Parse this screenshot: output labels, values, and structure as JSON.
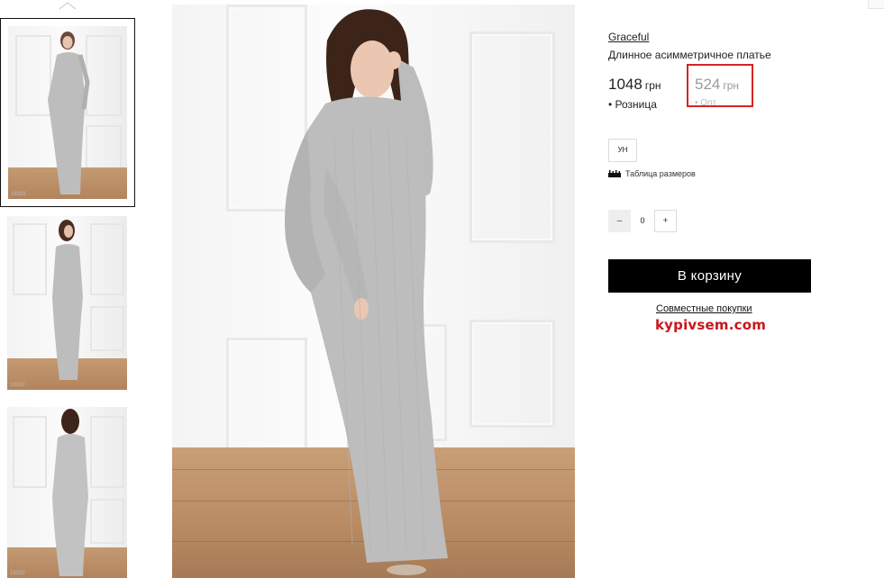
{
  "product": {
    "brand": "Graceful",
    "title": "Длинное асимметричное платье"
  },
  "prices": {
    "retail_value": "1048",
    "retail_currency": "грн",
    "retail_label": "• Розница",
    "wholesale_value": "524",
    "wholesale_currency": "грн",
    "wholesale_label": "• Опт"
  },
  "sizes": {
    "options": [
      "УН"
    ],
    "size_table_label": "Таблица размеров"
  },
  "quantity": {
    "minus": "–",
    "value": "0",
    "plus": "+"
  },
  "cart": {
    "button_label": "В корзину"
  },
  "promo": {
    "joint_purchases_link": "Совместные покупки",
    "site_logo": "kypivsem.com"
  },
  "gallery": {
    "thumbnail_codes": [
      "18332",
      "18332",
      "18332"
    ]
  },
  "colors": {
    "cart_button_bg": "#000000",
    "highlight_border": "#d62424",
    "logo_red": "#c8161d",
    "wholesale_price": "#9a9a9a",
    "dress": "#bdbdbd"
  },
  "icons": {
    "thumbs_scroll_up": "chevron-up-icon",
    "size_table": "ruler-icon"
  }
}
